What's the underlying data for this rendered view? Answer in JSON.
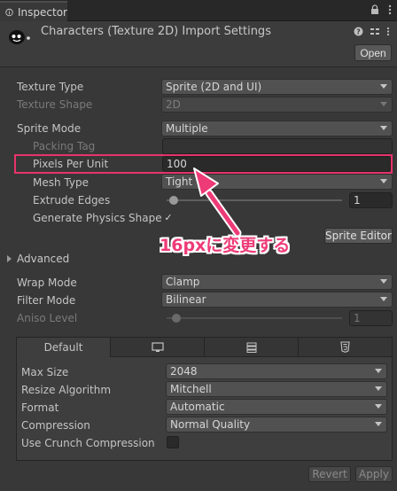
{
  "window": {
    "tab_title": "Inspector"
  },
  "header": {
    "title": "Characters (Texture 2D) Import Settings",
    "open_label": "Open"
  },
  "fields": {
    "texture_type": {
      "label": "Texture Type",
      "value": "Sprite (2D and UI)"
    },
    "texture_shape": {
      "label": "Texture Shape",
      "value": "2D"
    },
    "sprite_mode": {
      "label": "Sprite Mode",
      "value": "Multiple"
    },
    "packing_tag": {
      "label": "Packing Tag",
      "value": ""
    },
    "pixels_per_unit": {
      "label": "Pixels Per Unit",
      "value": "100"
    },
    "mesh_type": {
      "label": "Mesh Type",
      "value": "Tight"
    },
    "extrude_edges": {
      "label": "Extrude Edges",
      "value": "1"
    },
    "generate_physics_shape": {
      "label": "Generate Physics Shape",
      "checked": "✓"
    },
    "sprite_editor_label": "Sprite Editor",
    "advanced_label": "Advanced",
    "wrap_mode": {
      "label": "Wrap Mode",
      "value": "Clamp"
    },
    "filter_mode": {
      "label": "Filter Mode",
      "value": "Bilinear"
    },
    "aniso_level": {
      "label": "Aniso Level",
      "value": "1"
    }
  },
  "platform": {
    "tabs": [
      {
        "label": "Default",
        "icon": "default-tab"
      },
      {
        "label": "",
        "icon": "monitor-icon"
      },
      {
        "label": "",
        "icon": "server-icon"
      },
      {
        "label": "",
        "icon": "html5-icon"
      }
    ],
    "max_size": {
      "label": "Max Size",
      "value": "2048"
    },
    "resize_algorithm": {
      "label": "Resize Algorithm",
      "value": "Mitchell"
    },
    "format": {
      "label": "Format",
      "value": "Automatic"
    },
    "compression": {
      "label": "Compression",
      "value": "Normal Quality"
    },
    "use_crunch": {
      "label": "Use Crunch Compression"
    }
  },
  "footer": {
    "revert_label": "Revert",
    "apply_label": "Apply"
  },
  "annotation": {
    "text": "16pxに変更する",
    "color": "#ee3b78"
  },
  "colors": {
    "highlight": "#e8336b",
    "panel": "#383838"
  }
}
